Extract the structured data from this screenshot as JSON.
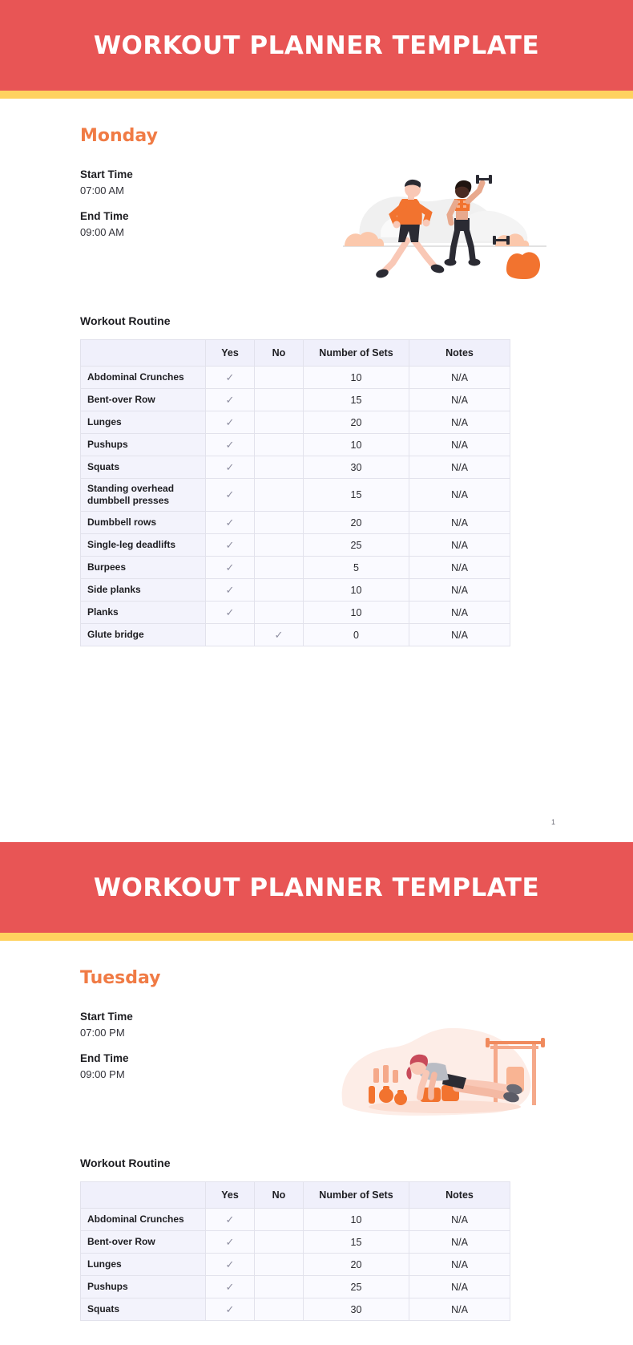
{
  "theme": {
    "banner_bg": "#E85555",
    "accent_bar": "#FFD25F",
    "day_color": "#F07B45",
    "table_head_bg": "#f0f0fb",
    "table_name_bg": "#f3f3fc",
    "table_cell_bg": "#fafaff",
    "border": "#e2e2ec"
  },
  "banner_title": "WORKOUT PLANNER TEMPLATE",
  "labels": {
    "start_time": "Start Time",
    "end_time": "End Time",
    "routine_heading": "Workout Routine",
    "check_mark": "✓"
  },
  "table_headers": {
    "exercise": "",
    "yes": "Yes",
    "no": "No",
    "sets": "Number of Sets",
    "notes": "Notes"
  },
  "pages": [
    {
      "page_number": "1",
      "day": "Monday",
      "start_time": "07:00 AM",
      "end_time": "09:00 AM",
      "illustration": "runner-and-dumbbell-woman-illustration",
      "rows": [
        {
          "exercise": "Abdominal Crunches",
          "yes": true,
          "no": false,
          "sets": "10",
          "notes": "N/A"
        },
        {
          "exercise": "Bent-over Row",
          "yes": true,
          "no": false,
          "sets": "15",
          "notes": "N/A"
        },
        {
          "exercise": "Lunges",
          "yes": true,
          "no": false,
          "sets": "20",
          "notes": "N/A"
        },
        {
          "exercise": "Pushups",
          "yes": true,
          "no": false,
          "sets": "10",
          "notes": "N/A"
        },
        {
          "exercise": "Squats",
          "yes": true,
          "no": false,
          "sets": "30",
          "notes": "N/A"
        },
        {
          "exercise": "Standing overhead dumbbell presses",
          "yes": true,
          "no": false,
          "sets": "15",
          "notes": "N/A"
        },
        {
          "exercise": "Dumbbell rows",
          "yes": true,
          "no": false,
          "sets": "20",
          "notes": "N/A"
        },
        {
          "exercise": "Single-leg deadlifts",
          "yes": true,
          "no": false,
          "sets": "25",
          "notes": "N/A"
        },
        {
          "exercise": "Burpees",
          "yes": true,
          "no": false,
          "sets": "5",
          "notes": "N/A"
        },
        {
          "exercise": "Side planks",
          "yes": true,
          "no": false,
          "sets": "10",
          "notes": "N/A"
        },
        {
          "exercise": "Planks",
          "yes": true,
          "no": false,
          "sets": "10",
          "notes": "N/A"
        },
        {
          "exercise": "Glute bridge",
          "yes": false,
          "no": true,
          "sets": "0",
          "notes": "N/A"
        }
      ]
    },
    {
      "page_number": "",
      "day": "Tuesday",
      "start_time": "07:00 PM",
      "end_time": "09:00 PM",
      "illustration": "pushup-person-with-gym-rack-illustration",
      "rows": [
        {
          "exercise": "Abdominal Crunches",
          "yes": true,
          "no": false,
          "sets": "10",
          "notes": "N/A"
        },
        {
          "exercise": "Bent-over Row",
          "yes": true,
          "no": false,
          "sets": "15",
          "notes": "N/A"
        },
        {
          "exercise": "Lunges",
          "yes": true,
          "no": false,
          "sets": "20",
          "notes": "N/A"
        },
        {
          "exercise": "Pushups",
          "yes": true,
          "no": false,
          "sets": "25",
          "notes": "N/A"
        },
        {
          "exercise": "Squats",
          "yes": true,
          "no": false,
          "sets": "30",
          "notes": "N/A"
        }
      ]
    }
  ]
}
